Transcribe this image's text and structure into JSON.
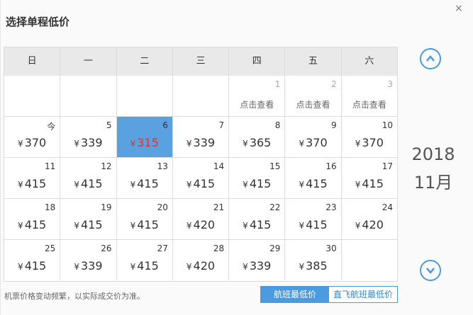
{
  "dialog": {
    "title": "选择单程低价",
    "close_glyph": "×"
  },
  "weekdays": [
    "日",
    "一",
    "二",
    "三",
    "四",
    "五",
    "六"
  ],
  "currency": "¥",
  "rows": [
    [
      {
        "empty": true
      },
      {
        "empty": true
      },
      {
        "empty": true
      },
      {
        "empty": true
      },
      {
        "day": "1",
        "check": "点击查看"
      },
      {
        "day": "2",
        "check": "点击查看"
      },
      {
        "day": "3",
        "check": "点击查看"
      }
    ],
    [
      {
        "day": "今",
        "price": "370"
      },
      {
        "day": "5",
        "price": "339"
      },
      {
        "day": "6",
        "price": "315",
        "selected": true
      },
      {
        "day": "7",
        "price": "339"
      },
      {
        "day": "8",
        "price": "365"
      },
      {
        "day": "9",
        "price": "370"
      },
      {
        "day": "10",
        "price": "370"
      }
    ],
    [
      {
        "day": "11",
        "price": "415"
      },
      {
        "day": "12",
        "price": "415"
      },
      {
        "day": "13",
        "price": "415"
      },
      {
        "day": "14",
        "price": "415"
      },
      {
        "day": "15",
        "price": "415"
      },
      {
        "day": "16",
        "price": "415"
      },
      {
        "day": "17",
        "price": "415"
      }
    ],
    [
      {
        "day": "18",
        "price": "415"
      },
      {
        "day": "19",
        "price": "415"
      },
      {
        "day": "20",
        "price": "415"
      },
      {
        "day": "21",
        "price": "420"
      },
      {
        "day": "22",
        "price": "415"
      },
      {
        "day": "23",
        "price": "415"
      },
      {
        "day": "24",
        "price": "420"
      }
    ],
    [
      {
        "day": "25",
        "price": "415"
      },
      {
        "day": "26",
        "price": "339"
      },
      {
        "day": "27",
        "price": "415"
      },
      {
        "day": "28",
        "price": "420"
      },
      {
        "day": "29",
        "price": "339"
      },
      {
        "day": "30",
        "price": "385"
      },
      {
        "empty": true
      }
    ]
  ],
  "side": {
    "year": "2018",
    "month": "11月",
    "up_icon": "chevron-up-icon",
    "down_icon": "chevron-down-icon"
  },
  "footer": {
    "note": "机票价格变动频繁，以实际成交价为准。",
    "tab_all": "航班最低价",
    "tab_direct": "直飞航班最低价"
  },
  "colors": {
    "accent": "#4a9be0",
    "selected_bg": "#5aa1e0",
    "selected_price": "#e0322b"
  }
}
